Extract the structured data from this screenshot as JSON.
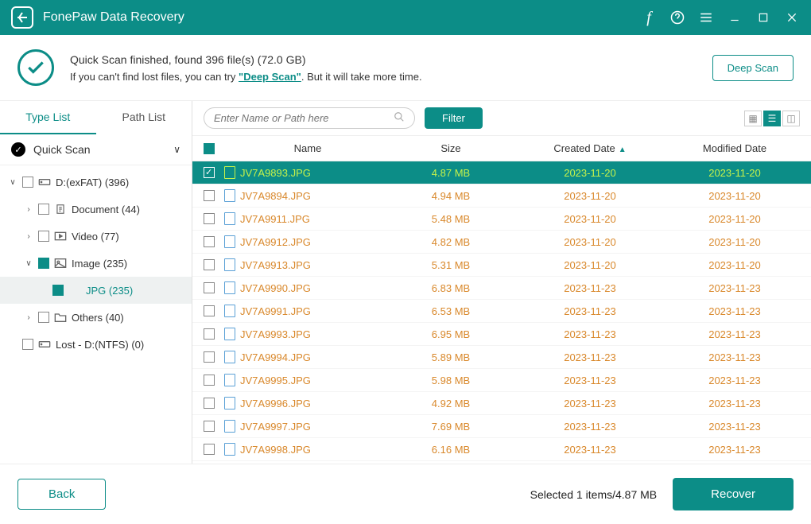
{
  "app": {
    "title": "FonePaw Data Recovery"
  },
  "banner": {
    "line1": "Quick Scan finished, found 396 file(s) (72.0 GB)",
    "line2a": "If you can't find lost files, you can try ",
    "deep_link": "\"Deep Scan\"",
    "line2b": ". But it will take more time.",
    "deep_btn": "Deep Scan"
  },
  "tabs": {
    "type": "Type List",
    "path": "Path List"
  },
  "tree_header": "Quick Scan",
  "tree": [
    {
      "label": "D:(exFAT) (396)",
      "indent": 0,
      "chev": "∨",
      "cb": "empty",
      "icon": "drive"
    },
    {
      "label": "Document (44)",
      "indent": 1,
      "chev": "›",
      "cb": "empty",
      "icon": "doc"
    },
    {
      "label": "Video (77)",
      "indent": 1,
      "chev": "›",
      "cb": "empty",
      "icon": "video"
    },
    {
      "label": "Image (235)",
      "indent": 1,
      "chev": "∨",
      "cb": "full",
      "icon": "image"
    },
    {
      "label": "JPG (235)",
      "indent": 2,
      "chev": "",
      "cb": "full",
      "icon": "",
      "selected": true
    },
    {
      "label": "Others (40)",
      "indent": 1,
      "chev": "›",
      "cb": "empty",
      "icon": "folder"
    },
    {
      "label": "Lost - D:(NTFS) (0)",
      "indent": 0,
      "chev": "",
      "cb": "empty",
      "icon": "drive"
    }
  ],
  "search_placeholder": "Enter Name or Path here",
  "filter_btn": "Filter",
  "columns": {
    "name": "Name",
    "size": "Size",
    "created": "Created Date",
    "modified": "Modified Date"
  },
  "rows": [
    {
      "name": "JV7A9893.JPG",
      "size": "4.87 MB",
      "created": "2023-11-20",
      "modified": "2023-11-20",
      "selected": true
    },
    {
      "name": "JV7A9894.JPG",
      "size": "4.94 MB",
      "created": "2023-11-20",
      "modified": "2023-11-20"
    },
    {
      "name": "JV7A9911.JPG",
      "size": "5.48 MB",
      "created": "2023-11-20",
      "modified": "2023-11-20"
    },
    {
      "name": "JV7A9912.JPG",
      "size": "4.82 MB",
      "created": "2023-11-20",
      "modified": "2023-11-20"
    },
    {
      "name": "JV7A9913.JPG",
      "size": "5.31 MB",
      "created": "2023-11-20",
      "modified": "2023-11-20"
    },
    {
      "name": "JV7A9990.JPG",
      "size": "6.83 MB",
      "created": "2023-11-23",
      "modified": "2023-11-23"
    },
    {
      "name": "JV7A9991.JPG",
      "size": "6.53 MB",
      "created": "2023-11-23",
      "modified": "2023-11-23"
    },
    {
      "name": "JV7A9993.JPG",
      "size": "6.95 MB",
      "created": "2023-11-23",
      "modified": "2023-11-23"
    },
    {
      "name": "JV7A9994.JPG",
      "size": "5.89 MB",
      "created": "2023-11-23",
      "modified": "2023-11-23"
    },
    {
      "name": "JV7A9995.JPG",
      "size": "5.98 MB",
      "created": "2023-11-23",
      "modified": "2023-11-23"
    },
    {
      "name": "JV7A9996.JPG",
      "size": "4.92 MB",
      "created": "2023-11-23",
      "modified": "2023-11-23"
    },
    {
      "name": "JV7A9997.JPG",
      "size": "7.69 MB",
      "created": "2023-11-23",
      "modified": "2023-11-23"
    },
    {
      "name": "JV7A9998.JPG",
      "size": "6.16 MB",
      "created": "2023-11-23",
      "modified": "2023-11-23"
    }
  ],
  "footer": {
    "back": "Back",
    "status": "Selected 1 items/4.87 MB",
    "recover": "Recover"
  }
}
